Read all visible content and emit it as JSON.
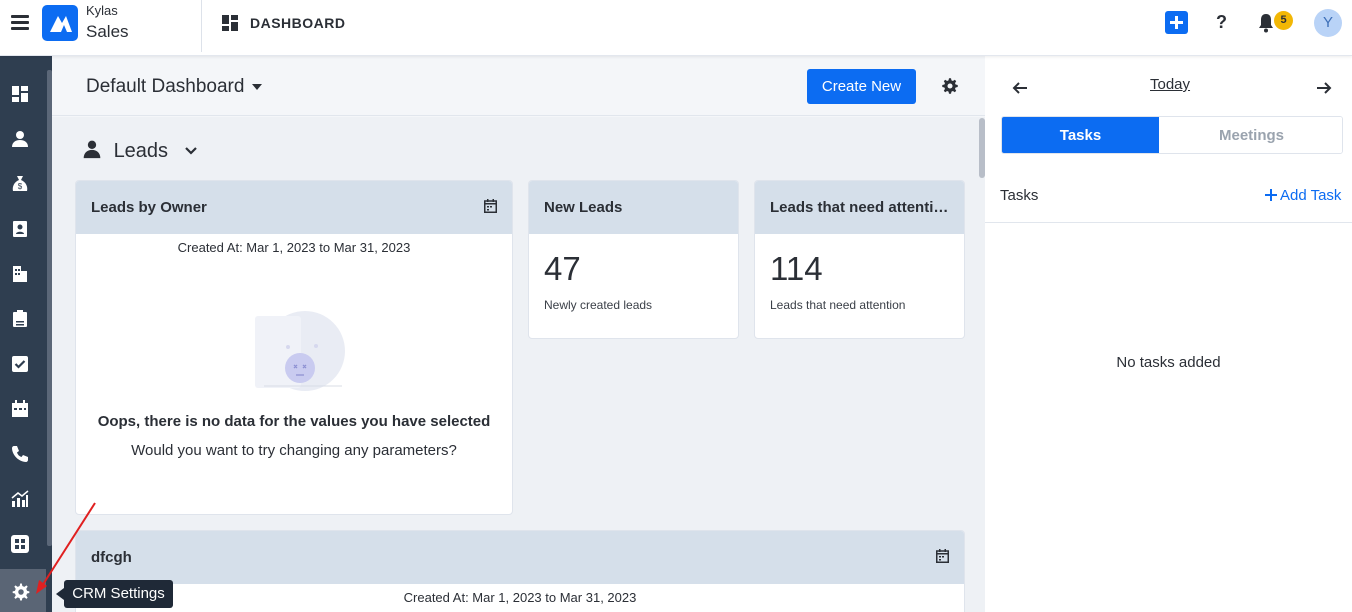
{
  "header": {
    "brand_top": "Kylas",
    "brand_bottom": "Sales",
    "page_title": "DASHBOARD",
    "notification_count": "5",
    "avatar_initial": "Y"
  },
  "sidebar": {
    "items": [
      {
        "icon": "dashboard-icon"
      },
      {
        "icon": "user-icon"
      },
      {
        "icon": "money-bag-icon"
      },
      {
        "icon": "contact-card-icon"
      },
      {
        "icon": "building-icon"
      },
      {
        "icon": "quote-document-icon"
      },
      {
        "icon": "checkbox-icon"
      },
      {
        "icon": "calendar-icon"
      },
      {
        "icon": "phone-icon"
      },
      {
        "icon": "report-chart-icon"
      },
      {
        "icon": "apps-grid-icon"
      },
      {
        "icon": "gear-icon"
      }
    ],
    "tooltip": "CRM Settings"
  },
  "main": {
    "dashboard_name": "Default Dashboard",
    "create_button": "Create New",
    "section_title": "Leads",
    "cards": {
      "leads_by_owner": {
        "title": "Leads by Owner",
        "created_at": "Created At: Mar 1, 2023 to Mar 31, 2023",
        "empty_title": "Oops, there is no data for the values you have selected",
        "empty_subtitle": "Would you want to try changing any parameters?"
      },
      "new_leads": {
        "title": "New Leads",
        "value": "47",
        "label": "Newly created leads"
      },
      "attention": {
        "title": "Leads that need attention",
        "value": "114",
        "label": "Leads that need attention"
      },
      "dfcgh": {
        "title": "dfcgh",
        "created_at": "Created At: Mar 1, 2023 to Mar 31, 2023"
      }
    }
  },
  "right_panel": {
    "date_label": "Today",
    "tabs": [
      "Tasks",
      "Meetings"
    ],
    "tasks_label": "Tasks",
    "add_task": "Add Task",
    "empty_text": "No tasks added"
  },
  "colors": {
    "primary": "#0c6cf2",
    "sidebar_bg": "#2f3e50",
    "card_header": "#d5dfea",
    "badge": "#f2b705"
  }
}
